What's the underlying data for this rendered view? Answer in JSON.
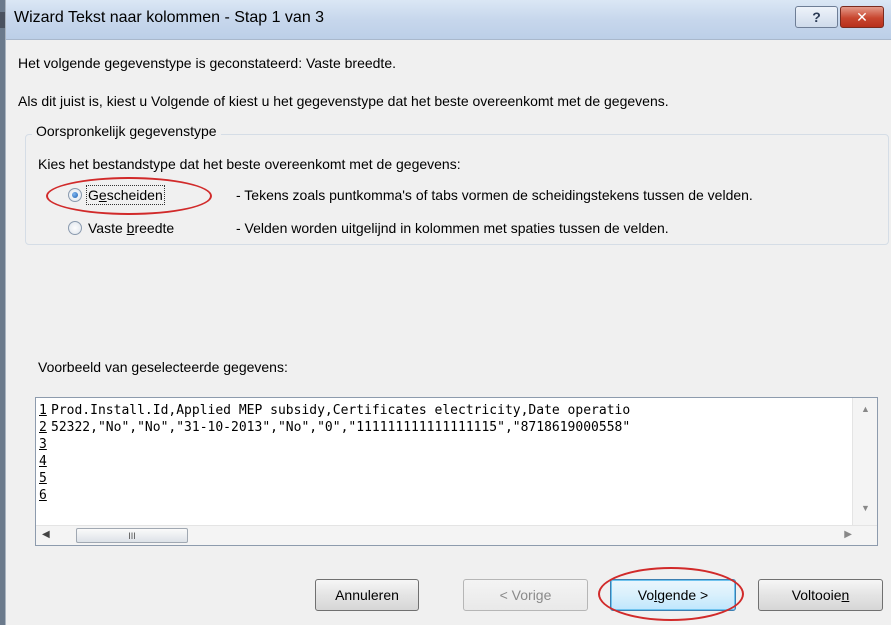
{
  "window": {
    "title": "Wizard Tekst naar kolommen - Stap 1 van 3",
    "help_label": "?",
    "close_label": "✕"
  },
  "intro": {
    "line1": "Het volgende gegevenstype is geconstateerd: Vaste breedte.",
    "line2": "Als dit juist is, kiest u Volgende of kiest u het gegevenstype dat het beste overeenkomt met de gegevens."
  },
  "original_type": {
    "legend": "Oorspronkelijk gegevenstype",
    "prompt": "Kies het bestandstype dat het beste overeenkomt met de gegevens:",
    "options": [
      {
        "label_pre": "G",
        "label_ul": "e",
        "label_post": "scheiden",
        "description": "- Tekens zoals puntkomma's of tabs vormen de scheidingstekens tussen de velden.",
        "selected": true
      },
      {
        "label_pre": "Vaste ",
        "label_ul": "b",
        "label_post": "reedte",
        "description": "- Velden worden uitgelijnd in kolommen met spaties tussen de velden.",
        "selected": false
      }
    ]
  },
  "preview": {
    "label": "Voorbeeld van geselecteerde gegevens:",
    "lines": [
      {
        "num": "1",
        "text": "Prod.Install.Id,Applied MEP subsidy,Certificates electricity,Date operatio"
      },
      {
        "num": "2",
        "text": "52322,\"No\",\"No\",\"31-10-2013\",\"No\",\"0\",\"111111111111111115\",\"8718619000558\""
      },
      {
        "num": "3",
        "text": ""
      },
      {
        "num": "4",
        "text": ""
      },
      {
        "num": "5",
        "text": ""
      },
      {
        "num": "6",
        "text": ""
      }
    ],
    "hscroll_thumb": "III"
  },
  "buttons": {
    "cancel": "Annuleren",
    "back": "< Vorige",
    "next_pre": "Vo",
    "next_ul": "l",
    "next_post": "gende >",
    "finish_pre": "Voltooie",
    "finish_ul": "n",
    "finish_post": ""
  },
  "colors": {
    "annotation": "#d12a2a",
    "title_bar": "#c7d7ec",
    "close_button": "#c8462f"
  }
}
